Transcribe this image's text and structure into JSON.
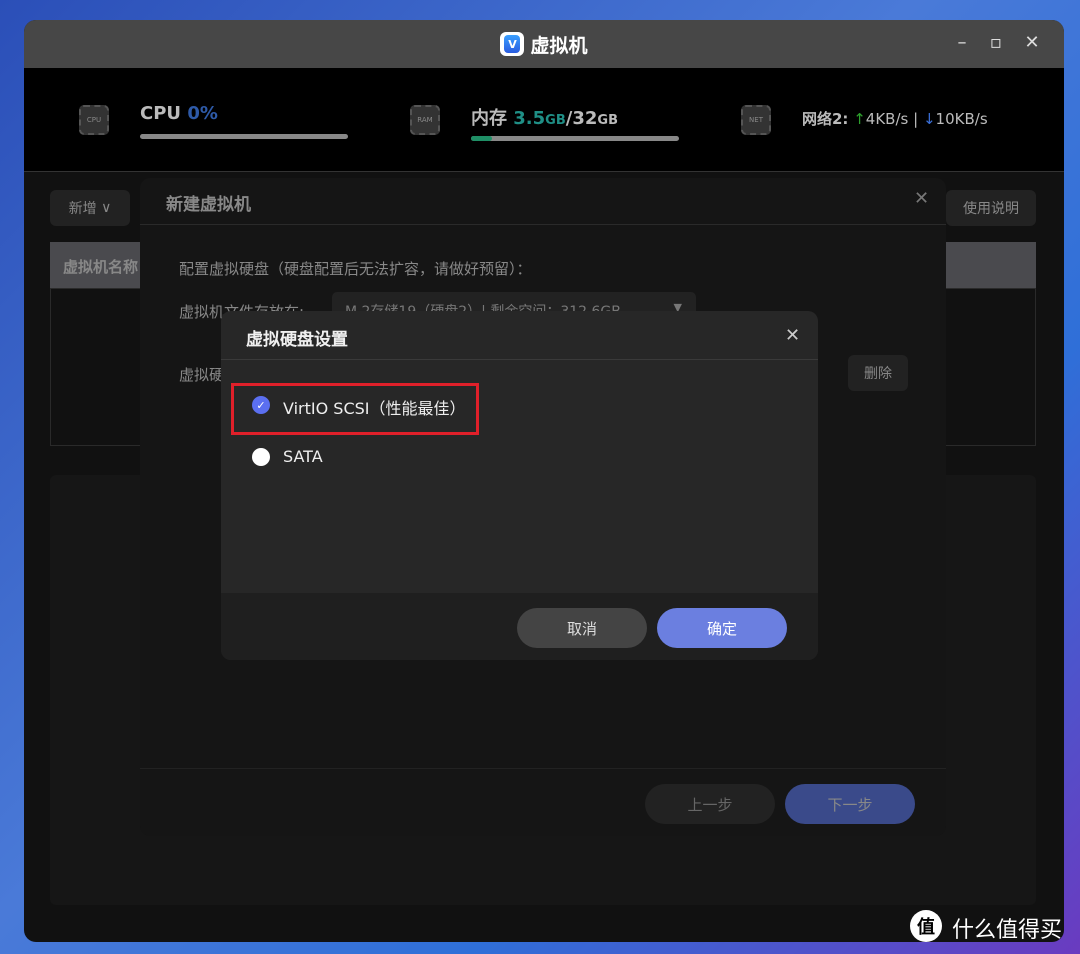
{
  "window": {
    "title": "虚拟机",
    "controls": [
      "minimize",
      "maximize",
      "close"
    ]
  },
  "header": {
    "cpu_label": "CPU",
    "cpu_value": "0%",
    "cpu_progress": 0,
    "mem_label": "内存",
    "mem_used": "3.5",
    "mem_used_unit": "GB",
    "mem_sep": "/",
    "mem_total": "32",
    "mem_total_unit": "GB",
    "mem_progress": 0.1,
    "net_label": "网络2:",
    "net_up": "4KB/s",
    "net_sep": "|",
    "net_down": "10KB/s",
    "colors": {
      "cpu": "#2e5aa8",
      "mem": "#1f8f86",
      "up": "#2ca02c",
      "down": "#3a6fd8"
    }
  },
  "toolbar": {
    "add": "新增",
    "help": "使用说明"
  },
  "table": {
    "header_first": "虚拟机名称"
  },
  "wizard": {
    "title": "新建虚拟机",
    "intro": "配置虚拟硬盘（硬盘配置后无法扩容，请做好预留）：",
    "location_label": "虚拟机文件存放在:",
    "location_value": "M.2存储19（硬盘2）| 剩余空间：312.6GB",
    "disk_label": "虚拟硬盘",
    "delete": "删除",
    "prev": "上一步",
    "next": "下一步"
  },
  "dialog": {
    "title": "虚拟硬盘设置",
    "options": [
      {
        "label": "VirtIO SCSI（性能最佳）",
        "selected": true
      },
      {
        "label": "SATA",
        "selected": false
      }
    ],
    "cancel": "取消",
    "ok": "确定",
    "accent": "#6b7fe0",
    "highlight": "#e0202a"
  },
  "watermark": "什么值得买"
}
